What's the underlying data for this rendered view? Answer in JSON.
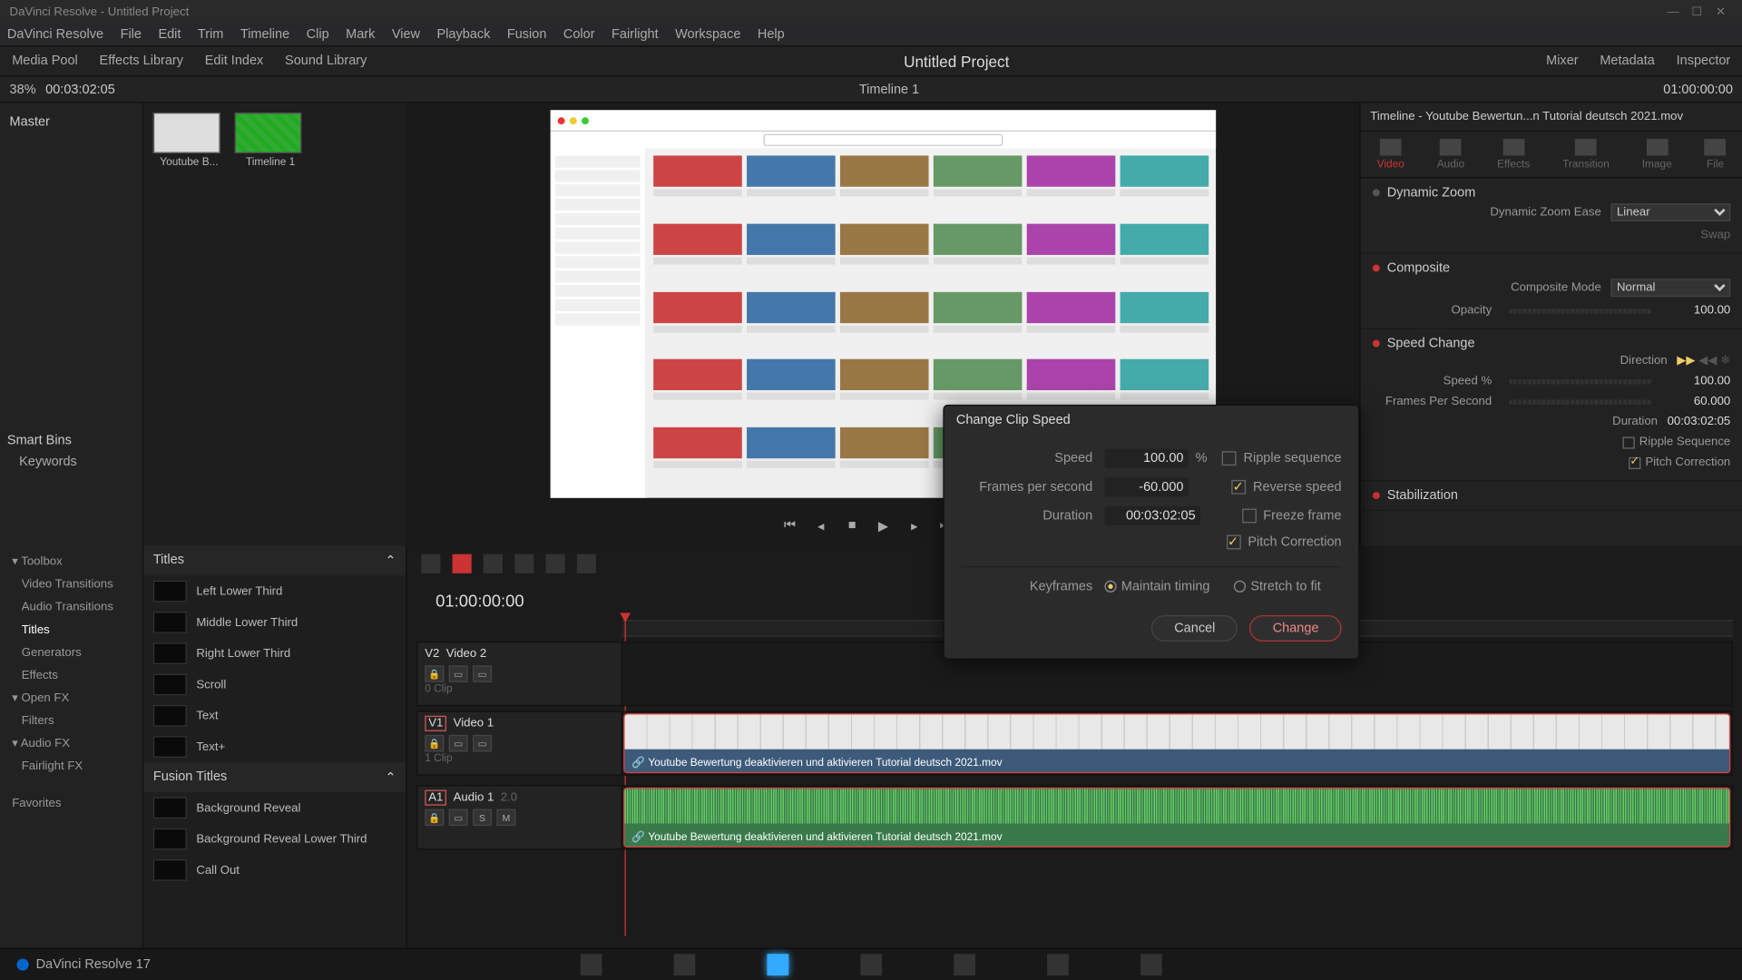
{
  "app": {
    "title": "DaVinci Resolve - Untitled Project",
    "version_label": "DaVinci Resolve 17"
  },
  "menu": [
    "DaVinci Resolve",
    "File",
    "Edit",
    "Trim",
    "Timeline",
    "Clip",
    "Mark",
    "View",
    "Playback",
    "Fusion",
    "Color",
    "Fairlight",
    "Workspace",
    "Help"
  ],
  "toolbar": {
    "media_pool": "Media Pool",
    "effects_library": "Effects Library",
    "edit_index": "Edit Index",
    "sound_library": "Sound Library",
    "mixer": "Mixer",
    "metadata": "Metadata",
    "inspector": "Inspector",
    "project_title": "Untitled Project"
  },
  "secbar": {
    "zoom": "38%",
    "tc": "00:03:02:05",
    "timeline_name": "Timeline 1",
    "source_tc": "01:00:00:00"
  },
  "mediapool": {
    "master": "Master",
    "smart_bins": "Smart Bins",
    "keywords": "Keywords",
    "clips": [
      {
        "name": "Youtube B..."
      },
      {
        "name": "Timeline 1"
      }
    ]
  },
  "inspector": {
    "header": "Timeline - Youtube Bewertun...n Tutorial deutsch 2021.mov",
    "tabs": [
      "Video",
      "Audio",
      "Effects",
      "Transition",
      "Image",
      "File"
    ],
    "dynamic_zoom": {
      "title": "Dynamic Zoom",
      "ease_label": "Dynamic Zoom Ease",
      "ease_value": "Linear",
      "swap": "Swap"
    },
    "composite": {
      "title": "Composite",
      "mode_label": "Composite Mode",
      "mode_value": "Normal",
      "opacity_label": "Opacity",
      "opacity_value": "100.00"
    },
    "speed": {
      "title": "Speed Change",
      "direction_label": "Direction",
      "speed_label": "Speed %",
      "speed_value": "100.00",
      "fps_label": "Frames Per Second",
      "fps_value": "60.000",
      "duration_label": "Duration",
      "duration_value": "00:03:02:05",
      "ripple": "Ripple Sequence",
      "pitch": "Pitch Correction"
    },
    "stabilization": {
      "title": "Stabilization"
    }
  },
  "fxpanel": {
    "toolbox": "Toolbox",
    "items": [
      "Video Transitions",
      "Audio Transitions",
      "Titles",
      "Generators",
      "Effects"
    ],
    "openfx": "Open FX",
    "filters": "Filters",
    "audiofx": "Audio FX",
    "fairlightfx": "Fairlight FX",
    "favorites": "Favorites"
  },
  "titles": {
    "group": "Titles",
    "list": [
      "Left Lower Third",
      "Middle Lower Third",
      "Right Lower Third",
      "Scroll",
      "Text",
      "Text+"
    ],
    "fusion_group": "Fusion Titles",
    "fusion_list": [
      "Background Reveal",
      "Background Reveal Lower Third",
      "Call Out"
    ]
  },
  "timeline": {
    "timecode": "01:00:00:00",
    "tracks": {
      "v2": {
        "tag": "V2",
        "name": "Video 2",
        "clips_label": "0 Clip"
      },
      "v1": {
        "tag": "V1",
        "name": "Video 1",
        "clips_label": "1 Clip"
      },
      "a1": {
        "tag": "A1",
        "name": "Audio 1",
        "ch": "2.0"
      }
    },
    "clip_name": "Youtube Bewertung deaktivieren und aktivieren Tutorial deutsch 2021.mov",
    "track_btns": {
      "solo": "S",
      "mute": "M"
    }
  },
  "dialog": {
    "title": "Change Clip Speed",
    "speed_label": "Speed",
    "speed_value": "100.00",
    "speed_unit": "%",
    "fps_label": "Frames per second",
    "fps_value": "-60.000",
    "duration_label": "Duration",
    "duration_value": "00:03:02:05",
    "ripple": "Ripple sequence",
    "reverse": "Reverse speed",
    "freeze": "Freeze frame",
    "pitch": "Pitch Correction",
    "keyframes_label": "Keyframes",
    "maintain": "Maintain timing",
    "stretch": "Stretch to fit",
    "cancel": "Cancel",
    "change": "Change"
  }
}
